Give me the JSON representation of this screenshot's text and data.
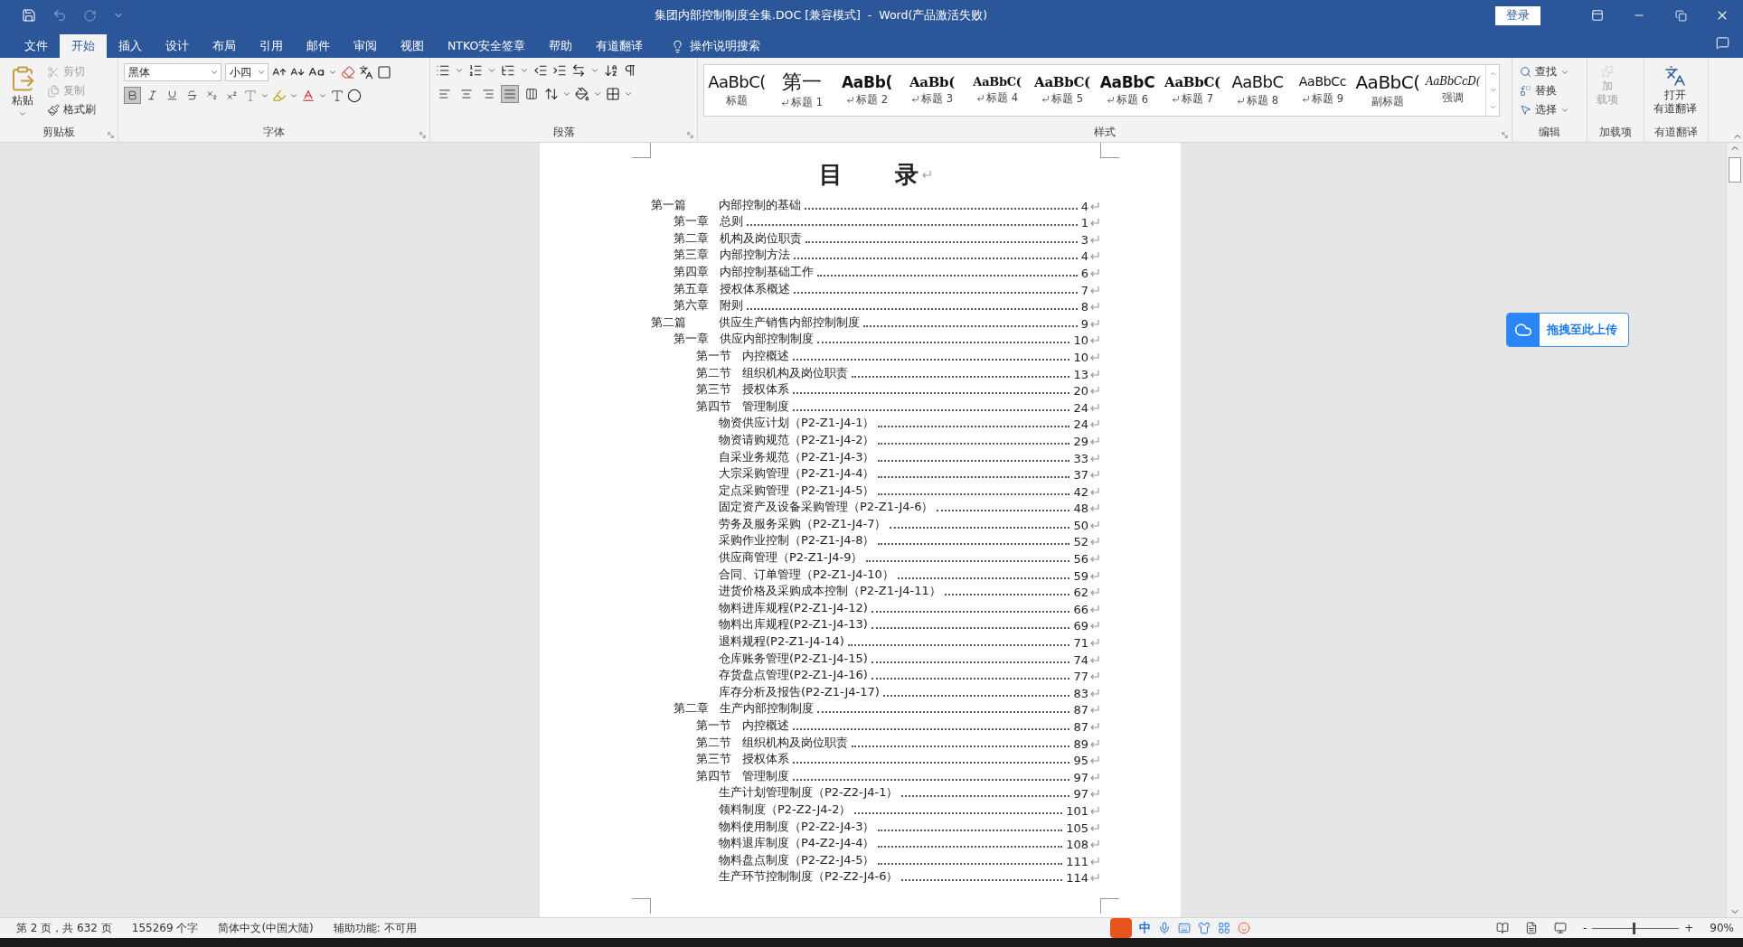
{
  "window": {
    "title": "集团内部控制制度全集.DOC [兼容模式]  -  Word(产品激活失败)",
    "sign_in": "登录"
  },
  "tabs": [
    {
      "label": "文件",
      "selected": false
    },
    {
      "label": "开始",
      "selected": true
    },
    {
      "label": "插入",
      "selected": false
    },
    {
      "label": "设计",
      "selected": false
    },
    {
      "label": "布局",
      "selected": false
    },
    {
      "label": "引用",
      "selected": false
    },
    {
      "label": "邮件",
      "selected": false
    },
    {
      "label": "审阅",
      "selected": false
    },
    {
      "label": "视图",
      "selected": false
    },
    {
      "label": "NTKO安全签章",
      "selected": false
    },
    {
      "label": "帮助",
      "selected": false
    },
    {
      "label": "有道翻译",
      "selected": false
    }
  ],
  "tell_me": "操作说明搜索",
  "ribbon": {
    "clipboard": {
      "label": "剪贴板",
      "paste": "粘贴",
      "items": [
        {
          "kind": "cut",
          "label": "剪切",
          "disabled": true
        },
        {
          "kind": "copy",
          "label": "复制",
          "disabled": true
        },
        {
          "kind": "painter",
          "label": "格式刷",
          "disabled": false
        }
      ]
    },
    "font": {
      "label": "字体",
      "font_name": "黑体",
      "font_size": "小四",
      "format_buttons": [
        {
          "kind": "bold",
          "pressed": true
        },
        {
          "kind": "italic",
          "pressed": false
        },
        {
          "kind": "underline",
          "pressed": false
        },
        {
          "kind": "strike",
          "pressed": false
        },
        {
          "kind": "sub",
          "pressed": false
        },
        {
          "kind": "sup",
          "pressed": false
        }
      ]
    },
    "paragraph": {
      "label": "段落",
      "align_buttons": [
        {
          "kind": "left",
          "selected": false
        },
        {
          "kind": "center",
          "selected": false
        },
        {
          "kind": "right",
          "selected": false
        },
        {
          "kind": "justify",
          "selected": true
        },
        {
          "kind": "distributed",
          "selected": false
        }
      ]
    },
    "styles": {
      "label": "样式",
      "items": [
        {
          "preview": "AaBbC(",
          "name": "标题",
          "kind": "light",
          "linked": false
        },
        {
          "preview": "第一",
          "name": "标题 1",
          "kind": "cjk",
          "linked": true
        },
        {
          "preview": "AaBb(",
          "name": "标题 2",
          "kind": "bold",
          "linked": true
        },
        {
          "preview": "AaBb(",
          "name": "标题 3",
          "kind": "serifbold",
          "linked": true
        },
        {
          "preview": "AaBbC(",
          "name": "标题 4",
          "kind": "serifsmall",
          "linked": true
        },
        {
          "preview": "AaBbC(",
          "name": "标题 5",
          "kind": "serifbold",
          "linked": true
        },
        {
          "preview": "AaBbC",
          "name": "标题 6",
          "kind": "bold",
          "linked": true
        },
        {
          "preview": "AaBbC(",
          "name": "标题 7",
          "kind": "serifbold",
          "linked": true
        },
        {
          "preview": "AaBbC",
          "name": "标题 8",
          "kind": "light",
          "linked": true
        },
        {
          "preview": "AaBbCc",
          "name": "标题 9",
          "kind": "small",
          "linked": true
        },
        {
          "preview": "AaBbC(",
          "name": "副标题",
          "kind": "large",
          "linked": false
        },
        {
          "preview": "AaBbCcD(",
          "name": "强调",
          "kind": "italic",
          "linked": false
        }
      ]
    },
    "editing": {
      "label": "编辑",
      "items": [
        {
          "kind": "find",
          "label": "查找"
        },
        {
          "kind": "replace",
          "label": "替换"
        },
        {
          "kind": "select",
          "label": "选择"
        }
      ]
    },
    "addins": {
      "label": "加载项",
      "button": [
        "加",
        "载项"
      ],
      "disabled": true
    },
    "youdao": {
      "label": "有道翻译",
      "button": [
        "打开",
        "有道翻译"
      ]
    }
  },
  "document": {
    "heading": "目　　录",
    "toc": [
      {
        "number": "第一篇",
        "title": "内部控制的基础",
        "page": "4",
        "children": [
          {
            "number": "第一章",
            "title": "总则",
            "page": "1"
          },
          {
            "number": "第二章",
            "title": "机构及岗位职责",
            "page": "3"
          },
          {
            "number": "第三章",
            "title": "内部控制方法",
            "page": "4"
          },
          {
            "number": "第四章",
            "title": "内部控制基础工作",
            "page": "6"
          },
          {
            "number": "第五章",
            "title": "授权体系概述",
            "page": "7"
          },
          {
            "number": "第六章",
            "title": "附则",
            "page": "8"
          }
        ]
      },
      {
        "number": "第二篇",
        "title": "供应生产销售内部控制制度",
        "page": "9",
        "children": [
          {
            "number": "第一章",
            "title": "供应内部控制制度",
            "page": "10",
            "children": [
              {
                "number": "第一节",
                "title": "内控概述",
                "page": "10"
              },
              {
                "number": "第二节",
                "title": "组织机构及岗位职责",
                "page": "13"
              },
              {
                "number": "第三节",
                "title": "授权体系",
                "page": "20"
              },
              {
                "number": "第四节",
                "title": "管理制度",
                "page": "24",
                "children": [
                  {
                    "title": "物资供应计划（P2-Z1-J4-1）",
                    "page": "24"
                  },
                  {
                    "title": "物资请购规范（P2-Z1-J4-2）",
                    "page": "29"
                  },
                  {
                    "title": "自采业务规范（P2-Z1-J4-3）",
                    "page": "33"
                  },
                  {
                    "title": "大宗采购管理（P2-Z1-J4-4）",
                    "page": "37"
                  },
                  {
                    "title": "定点采购管理（P2-Z1-J4-5）",
                    "page": "42"
                  },
                  {
                    "title": "固定资产及设备采购管理（P2-Z1-J4-6）",
                    "page": "48"
                  },
                  {
                    "title": "劳务及服务采购（P2-Z1-J4-7）",
                    "page": "50"
                  },
                  {
                    "title": "采购作业控制（P2-Z1-J4-8）",
                    "page": "52"
                  },
                  {
                    "title": "供应商管理（P2-Z1-J4-9）",
                    "page": "56"
                  },
                  {
                    "title": "合同、订单管理（P2-Z1-J4-10）",
                    "page": "59"
                  },
                  {
                    "title": "进货价格及采购成本控制（P2-Z1-J4-11）",
                    "page": "62"
                  },
                  {
                    "title": "物料进库规程(P2-Z1-J4-12)",
                    "page": "66"
                  },
                  {
                    "title": "物料出库规程(P2-Z1-J4-13)",
                    "page": "69"
                  },
                  {
                    "title": "退料规程(P2-Z1-J4-14)",
                    "page": "71"
                  },
                  {
                    "title": "仓库账务管理(P2-Z1-J4-15)",
                    "page": "74"
                  },
                  {
                    "title": "存货盘点管理(P2-Z1-J4-16)",
                    "page": "77"
                  },
                  {
                    "title": "库存分析及报告(P2-Z1-J4-17)",
                    "page": "83"
                  }
                ]
              }
            ]
          },
          {
            "number": "第二章",
            "title": "生产内部控制制度",
            "page": "87",
            "children": [
              {
                "number": "第一节",
                "title": "内控概述",
                "page": "87"
              },
              {
                "number": "第二节",
                "title": "组织机构及岗位职责",
                "page": "89"
              },
              {
                "number": "第三节",
                "title": "授权体系",
                "page": "95"
              },
              {
                "number": "第四节",
                "title": "管理制度",
                "page": "97",
                "children": [
                  {
                    "title": "生产计划管理制度（P2-Z2-J4-1）",
                    "page": "97"
                  },
                  {
                    "title": "领料制度（P2-Z2-J4-2）",
                    "page": "101"
                  },
                  {
                    "title": "物料使用制度（P2-Z2-J4-3）",
                    "page": "105"
                  },
                  {
                    "title": "物料退库制度（P4-Z2-J4-4）",
                    "page": "108"
                  },
                  {
                    "title": "物料盘点制度（P2-Z2-J4-5）",
                    "page": "111"
                  },
                  {
                    "title": "生产环节控制制度（P2-Z2-J4-6）",
                    "page": "114"
                  }
                ]
              }
            ]
          }
        ]
      }
    ]
  },
  "upload_button": "拖拽至此上传",
  "status_bar": {
    "page": "第 2 页，共 632 页",
    "words": "155269 个字",
    "language": "简体中文(中国大陆)",
    "accessibility": "辅助功能: 不可用",
    "ime": "中",
    "zoom": {
      "level": 0.47,
      "minus": "-",
      "plus": "+",
      "value": "90%"
    }
  }
}
